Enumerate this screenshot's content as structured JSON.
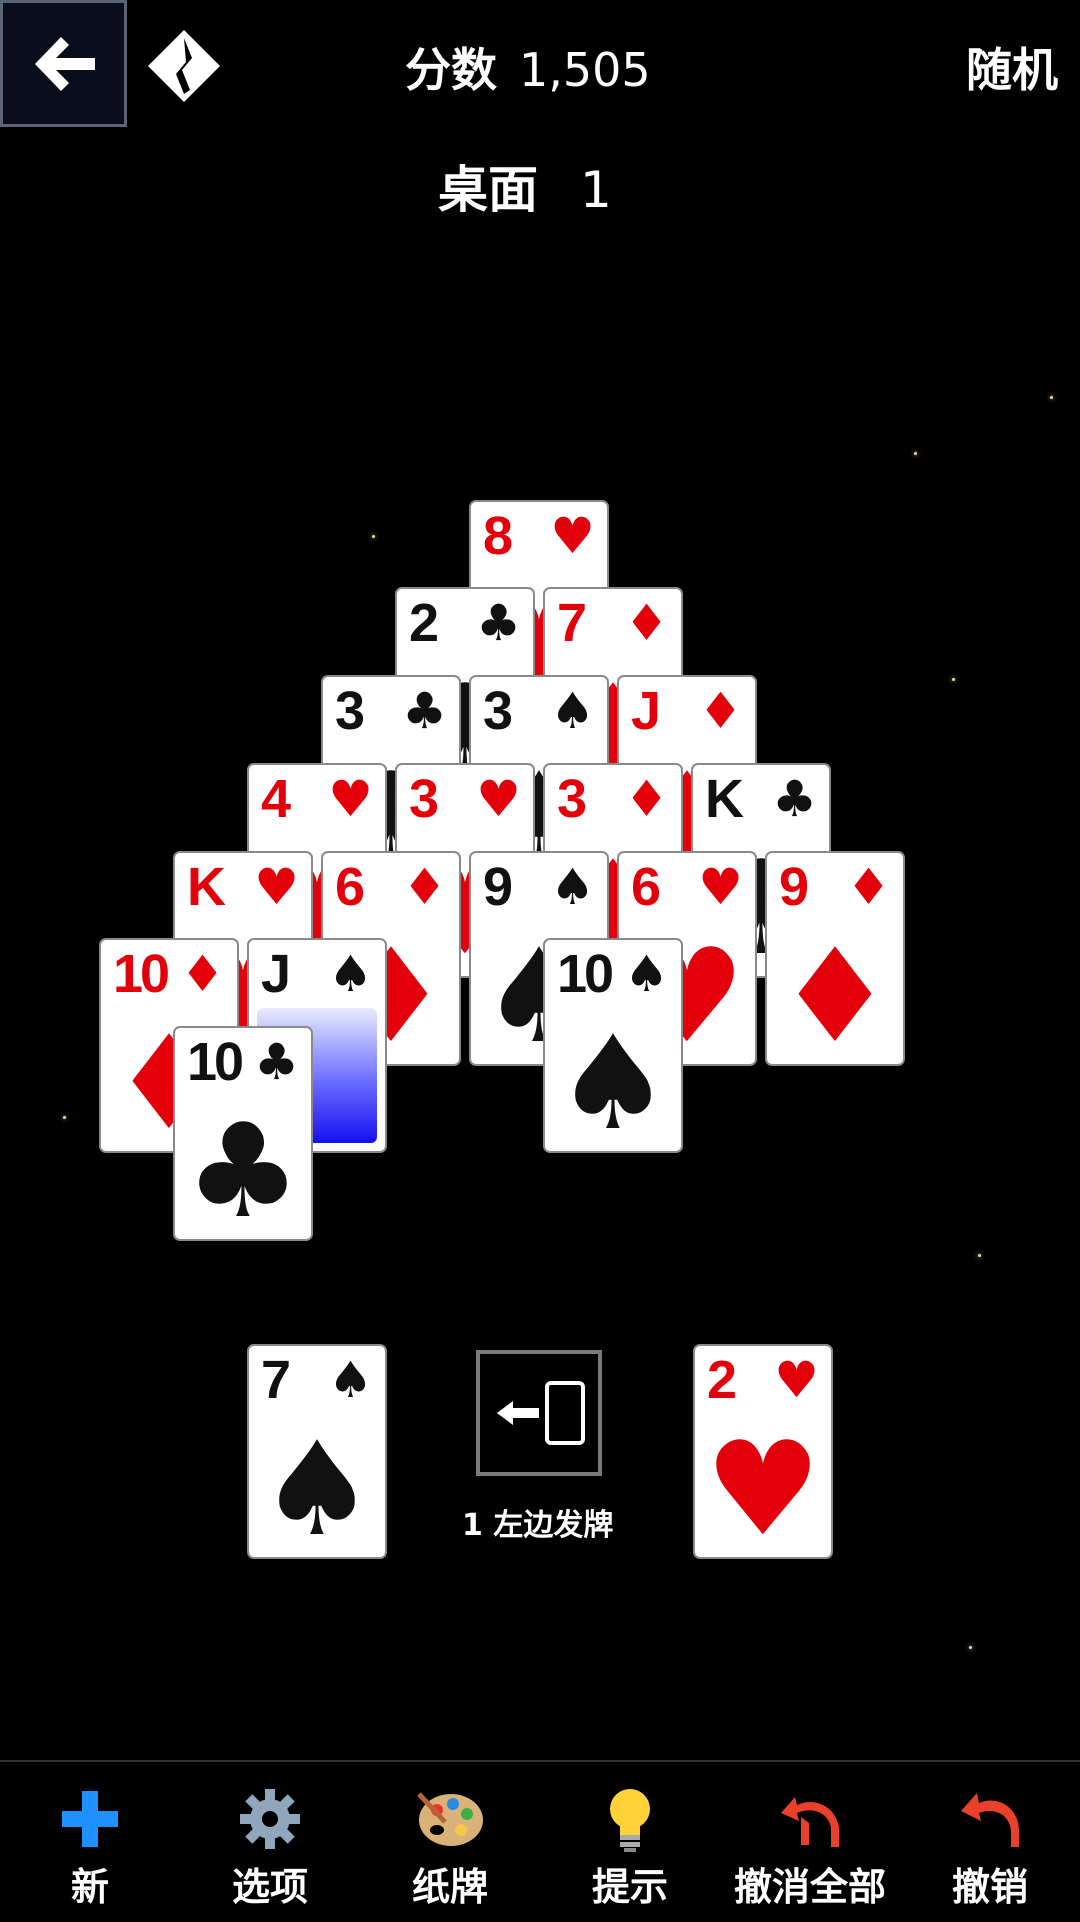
{
  "header": {
    "score_label": "分数",
    "score_value": "1,505",
    "mode_label": "随机",
    "deal_label": "桌面",
    "deal_value": "1"
  },
  "pyramid": [
    {
      "rank": "8",
      "suit": "♥",
      "color": "red"
    },
    {
      "rank": "2",
      "suit": "♣",
      "color": "black"
    },
    {
      "rank": "7",
      "suit": "♦",
      "color": "red"
    },
    {
      "rank": "3",
      "suit": "♣",
      "color": "black"
    },
    {
      "rank": "3",
      "suit": "♠",
      "color": "black"
    },
    {
      "rank": "J",
      "suit": "♦",
      "color": "red"
    },
    {
      "rank": "4",
      "suit": "♥",
      "color": "red"
    },
    {
      "rank": "3",
      "suit": "♥",
      "color": "red"
    },
    {
      "rank": "3",
      "suit": "♦",
      "color": "red"
    },
    {
      "rank": "K",
      "suit": "♣",
      "color": "black"
    },
    {
      "rank": "K",
      "suit": "♥",
      "color": "red"
    },
    {
      "rank": "6",
      "suit": "♦",
      "color": "red"
    },
    {
      "rank": "9",
      "suit": "♠",
      "color": "black"
    },
    {
      "rank": "6",
      "suit": "♥",
      "color": "red"
    },
    {
      "rank": "9",
      "suit": "♦",
      "color": "red"
    },
    {
      "rank": "10",
      "suit": "♦",
      "color": "red"
    },
    {
      "rank": "J",
      "suit": "♠",
      "color": "black"
    },
    {
      "rank": "10",
      "suit": "♠",
      "color": "black"
    },
    {
      "rank": "10",
      "suit": "♣",
      "color": "black"
    }
  ],
  "waste_left": {
    "rank": "7",
    "suit": "♠",
    "color": "black"
  },
  "waste_right": {
    "rank": "2",
    "suit": "♥",
    "color": "red"
  },
  "stock_label": "1 左边发牌",
  "toolbar": {
    "new": "新",
    "options": "选项",
    "cards": "纸牌",
    "hint": "提示",
    "undo_all": "撤消全部",
    "undo": "撤销"
  },
  "colors": {
    "red_suit": "#e3000b",
    "black_suit": "#111111",
    "accent_blue": "#1e90ff",
    "undo_red": "#e8402a"
  },
  "icons": [
    "back-arrow-icon",
    "logo-icon",
    "stock-deal-icon",
    "plus-icon",
    "gear-icon",
    "palette-icon",
    "lightbulb-icon",
    "undo-all-icon",
    "undo-icon"
  ]
}
